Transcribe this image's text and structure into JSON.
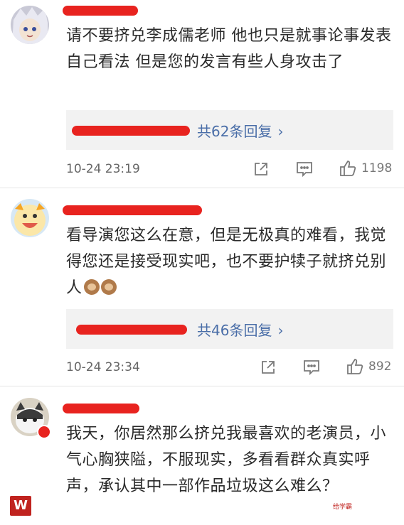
{
  "comments": [
    {
      "text": "请不要挤兑李成儒老师 他也只是就事论事发表自己看法 但是您的发言有些人身攻击了",
      "reply_count": "共62条回复",
      "timestamp": "10-24 23:19",
      "likes": "1198"
    },
    {
      "text": "看导演您这么在意，但是无极真的难看，我觉得您还是接受现实吧，也不要护犊子就挤兑别人",
      "reply_count": "共46条回复",
      "timestamp": "10-24 23:34",
      "likes": "892"
    },
    {
      "text": "我天，你居然那么挤兑我最喜欢的老演员，小气心胸狭隘，不服现实，多看看群众真实呼声，承认其中一部作品垃圾这么难么？"
    }
  ],
  "icons": [
    "share-icon",
    "comment-icon",
    "like-icon",
    "chevron-right-icon"
  ],
  "colors": {
    "redaction": "#e8231f",
    "link": "#4a6ea8",
    "reply_bg": "#f2f2f2"
  },
  "watermark": {
    "left": "W",
    "right": "给学霸"
  }
}
